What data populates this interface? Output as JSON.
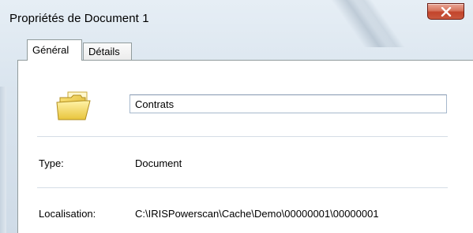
{
  "window": {
    "title": "Propriétés de Document 1",
    "close_label": "close"
  },
  "tabs": [
    {
      "label": "Général",
      "active": true
    },
    {
      "label": "Détails",
      "active": false
    }
  ],
  "general": {
    "icon": "folder-icon",
    "name_value": "Contrats",
    "type_label": "Type:",
    "type_value": "Document",
    "location_label": "Localisation:",
    "location_value": "C:\\IRISPowerscan\\Cache\\Demo\\00000001\\00000001"
  },
  "colors": {
    "close_button": "#c9593f",
    "folder": "#f2d65a"
  }
}
